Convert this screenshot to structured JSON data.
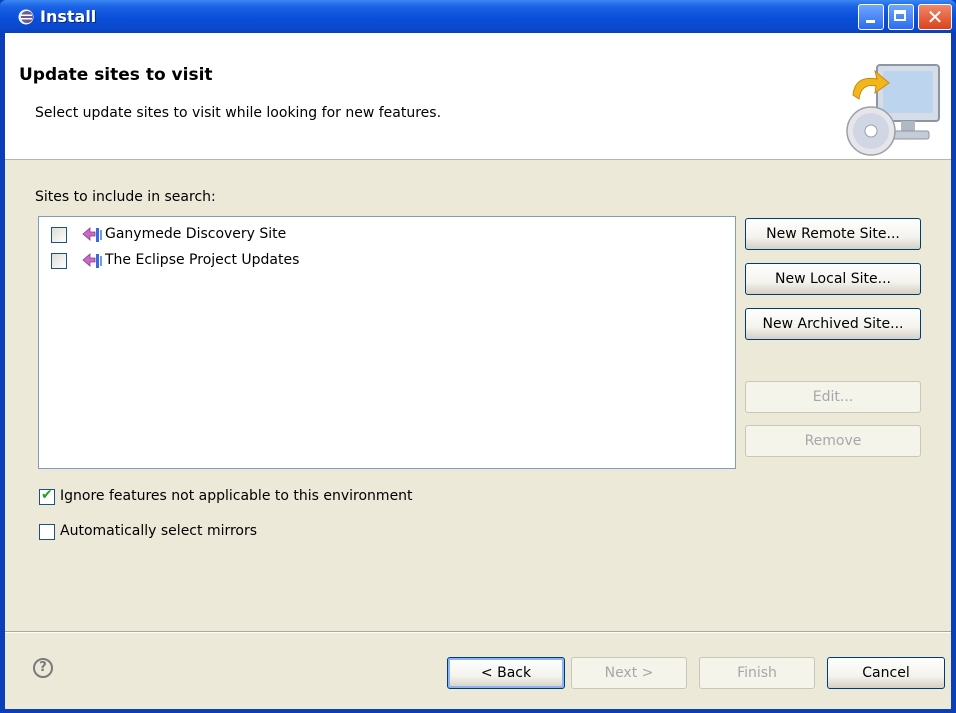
{
  "window": {
    "title": "Install",
    "controls": {
      "minimize": "minimize",
      "maximize": "maximize",
      "close": "✕"
    }
  },
  "header": {
    "title": "Update sites to visit",
    "description": "Select update sites to visit while looking for new features.",
    "banner_icon": "install-computer-cd-icon"
  },
  "sites": {
    "label": "Sites to include in search:",
    "items": [
      {
        "label": "Ganymede Discovery Site",
        "checked": false,
        "icon": "update-site-icon"
      },
      {
        "label": "The Eclipse Project Updates",
        "checked": false,
        "icon": "update-site-icon"
      }
    ]
  },
  "side_buttons": {
    "new_remote": "New Remote Site...",
    "new_local": "New Local Site...",
    "new_archived": "New Archived Site...",
    "edit": "Edit...",
    "remove": "Remove"
  },
  "options": {
    "ignore_features": {
      "label": "Ignore features not applicable to this environment",
      "checked": true
    },
    "auto_mirrors": {
      "label": "Automatically select mirrors",
      "checked": false
    }
  },
  "footer": {
    "help": "?",
    "back": "< Back",
    "next": "Next >",
    "finish": "Finish",
    "cancel": "Cancel"
  },
  "colors": {
    "titlebar": "#0a4fd8",
    "dialog_bg": "#ece9d8",
    "header_bg": "#ffffff",
    "disabled_text": "#a7a6aa",
    "list_border": "#7f9db9"
  }
}
